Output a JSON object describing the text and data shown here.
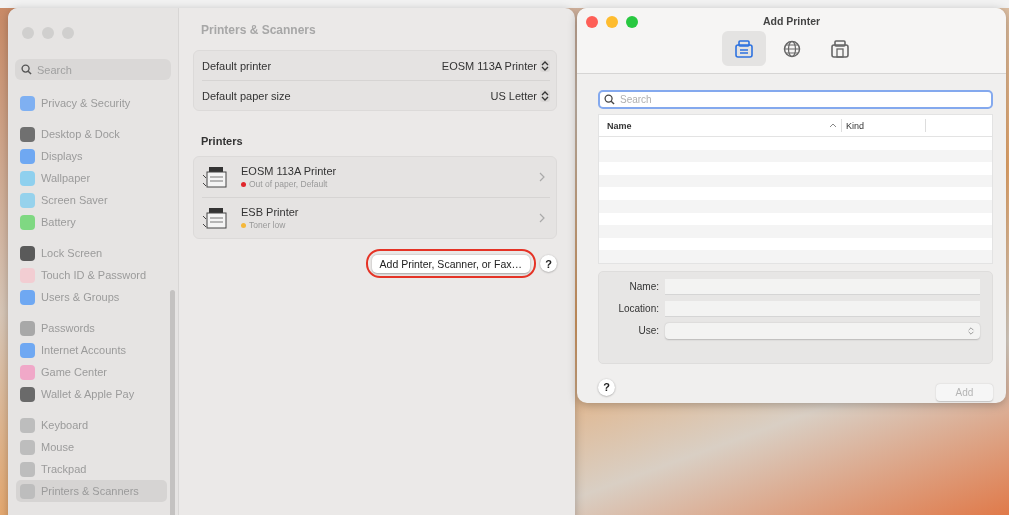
{
  "settings": {
    "active": false,
    "search_placeholder": "Search",
    "sidebar": [
      [
        {
          "label": "Privacy & Security",
          "color": "#7fb0f2",
          "selected": false
        }
      ],
      [
        {
          "label": "Desktop & Dock",
          "color": "#707070",
          "selected": false
        },
        {
          "label": "Displays",
          "color": "#6fa8f2",
          "selected": false
        },
        {
          "label": "Wallpaper",
          "color": "#8fd0ee",
          "selected": false
        },
        {
          "label": "Screen Saver",
          "color": "#96d2ec",
          "selected": false
        },
        {
          "label": "Battery",
          "color": "#7fd882",
          "selected": false
        }
      ],
      [
        {
          "label": "Lock Screen",
          "color": "#5a5a5a",
          "selected": false
        },
        {
          "label": "Touch ID & Password",
          "color": "#f2cdd2",
          "selected": false
        },
        {
          "label": "Users & Groups",
          "color": "#6fa8f2",
          "selected": false
        }
      ],
      [
        {
          "label": "Passwords",
          "color": "#a8a8a8",
          "selected": false
        },
        {
          "label": "Internet Accounts",
          "color": "#6fa8f2",
          "selected": false
        },
        {
          "label": "Game Center",
          "color": "#f0a8c8",
          "selected": false
        },
        {
          "label": "Wallet & Apple Pay",
          "color": "#6a6a6a",
          "selected": false
        }
      ],
      [
        {
          "label": "Keyboard",
          "color": "#bdbdbd",
          "selected": false
        },
        {
          "label": "Mouse",
          "color": "#bdbdbd",
          "selected": false
        },
        {
          "label": "Trackpad",
          "color": "#bdbdbd",
          "selected": false
        },
        {
          "label": "Printers & Scanners",
          "color": "#bdbdbd",
          "selected": true
        }
      ]
    ],
    "title": "Printers & Scanners",
    "defaults": [
      {
        "label": "Default printer",
        "value": "EOSM 113A Printer"
      },
      {
        "label": "Default paper size",
        "value": "US Letter"
      }
    ],
    "printers_heading": "Printers",
    "printers": [
      {
        "name": "EOSM 113A Printer",
        "status": "Out of paper, Default",
        "color": "#e0262c"
      },
      {
        "name": "ESB Printer",
        "status": "Toner low",
        "color": "#f5b83a"
      }
    ],
    "add_button": {
      "label": "Add Printer, Scanner, or Fax…",
      "highlighted": true
    },
    "help": "?"
  },
  "add_printer": {
    "active": true,
    "title": "Add Printer",
    "toolbar": [
      {
        "kind": "default",
        "selected": true
      },
      {
        "kind": "ip",
        "selected": false
      },
      {
        "kind": "windows",
        "selected": false
      }
    ],
    "search_placeholder": "Search",
    "columns": [
      {
        "label": "Name",
        "sorted": true
      },
      {
        "label": "Kind",
        "sorted": false
      }
    ],
    "fields": [
      {
        "label": "Name:",
        "kind": "text"
      },
      {
        "label": "Location:",
        "kind": "text"
      },
      {
        "label": "Use:",
        "kind": "select"
      }
    ],
    "help": "?",
    "add_button": {
      "label": "Add",
      "disabled": true
    }
  }
}
